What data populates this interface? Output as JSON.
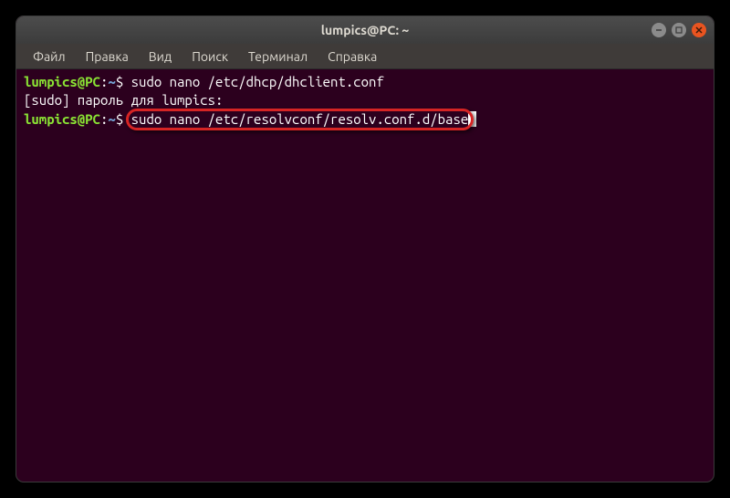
{
  "window": {
    "title": "lumpics@PC: ~"
  },
  "menubar": {
    "items": [
      {
        "label": "Файл"
      },
      {
        "label": "Правка"
      },
      {
        "label": "Вид"
      },
      {
        "label": "Поиск"
      },
      {
        "label": "Терминал"
      },
      {
        "label": "Справка"
      }
    ]
  },
  "terminal": {
    "prompt_user": "lumpics@PC",
    "prompt_sep": ":",
    "prompt_path": "~",
    "prompt_symbol": "$",
    "lines": [
      {
        "type": "cmd",
        "command": "sudo nano /etc/dhcp/dhclient.conf"
      },
      {
        "type": "text",
        "content": "[sudo] пароль для lumpics: "
      },
      {
        "type": "cmd_highlighted",
        "command": "sudo nano /etc/resolvconf/resolv.conf.d/base"
      }
    ]
  }
}
